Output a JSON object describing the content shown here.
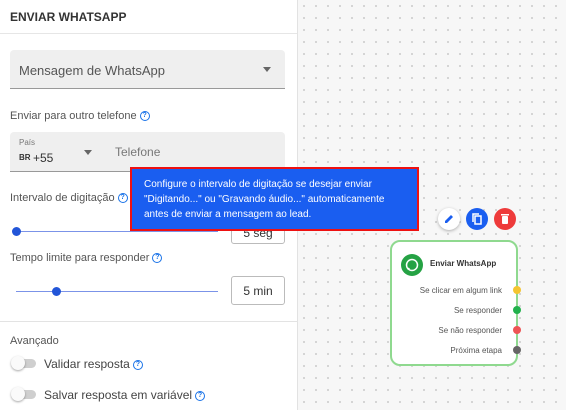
{
  "panel": {
    "title": "ENVIAR WHATSAPP",
    "message_select": "Mensagem de WhatsApp",
    "other_phone_label": "Enviar para outro telefone",
    "country_label": "País",
    "country_flag": "BR",
    "country_code": "+55",
    "phone_placeholder": "Telefone",
    "typing_interval_label": "Intervalo de digitação",
    "typing_interval_value": "5 seg",
    "typing_interval_fraction": 0.0,
    "timeout_label": "Tempo limite para responder",
    "timeout_value": "5 min",
    "timeout_fraction": 0.2,
    "advanced_label": "Avançado",
    "validate_label": "Validar resposta",
    "validate_on": false,
    "save_label": "Salvar resposta em variável",
    "save_on": false
  },
  "tooltip": {
    "text": "Configure o intervalo de digitação se desejar enviar \"Digitando...\" ou \"Gravando áudio...\" automaticamente antes de enviar a mensagem ao lead."
  },
  "node": {
    "title": "Enviar WhatsApp",
    "icon": "whatsapp-icon",
    "ports": [
      {
        "label": "Se clicar em algum link",
        "color": "#f4c430"
      },
      {
        "label": "Se responder",
        "color": "#22b14c"
      },
      {
        "label": "Se não responder",
        "color": "#ee5555"
      },
      {
        "label": "Próxima etapa",
        "color": "#666666"
      }
    ]
  },
  "node_actions": {
    "edit_color": "#ffffff",
    "copy_color": "#1a5ef0",
    "delete_color": "#ee3b3b"
  }
}
